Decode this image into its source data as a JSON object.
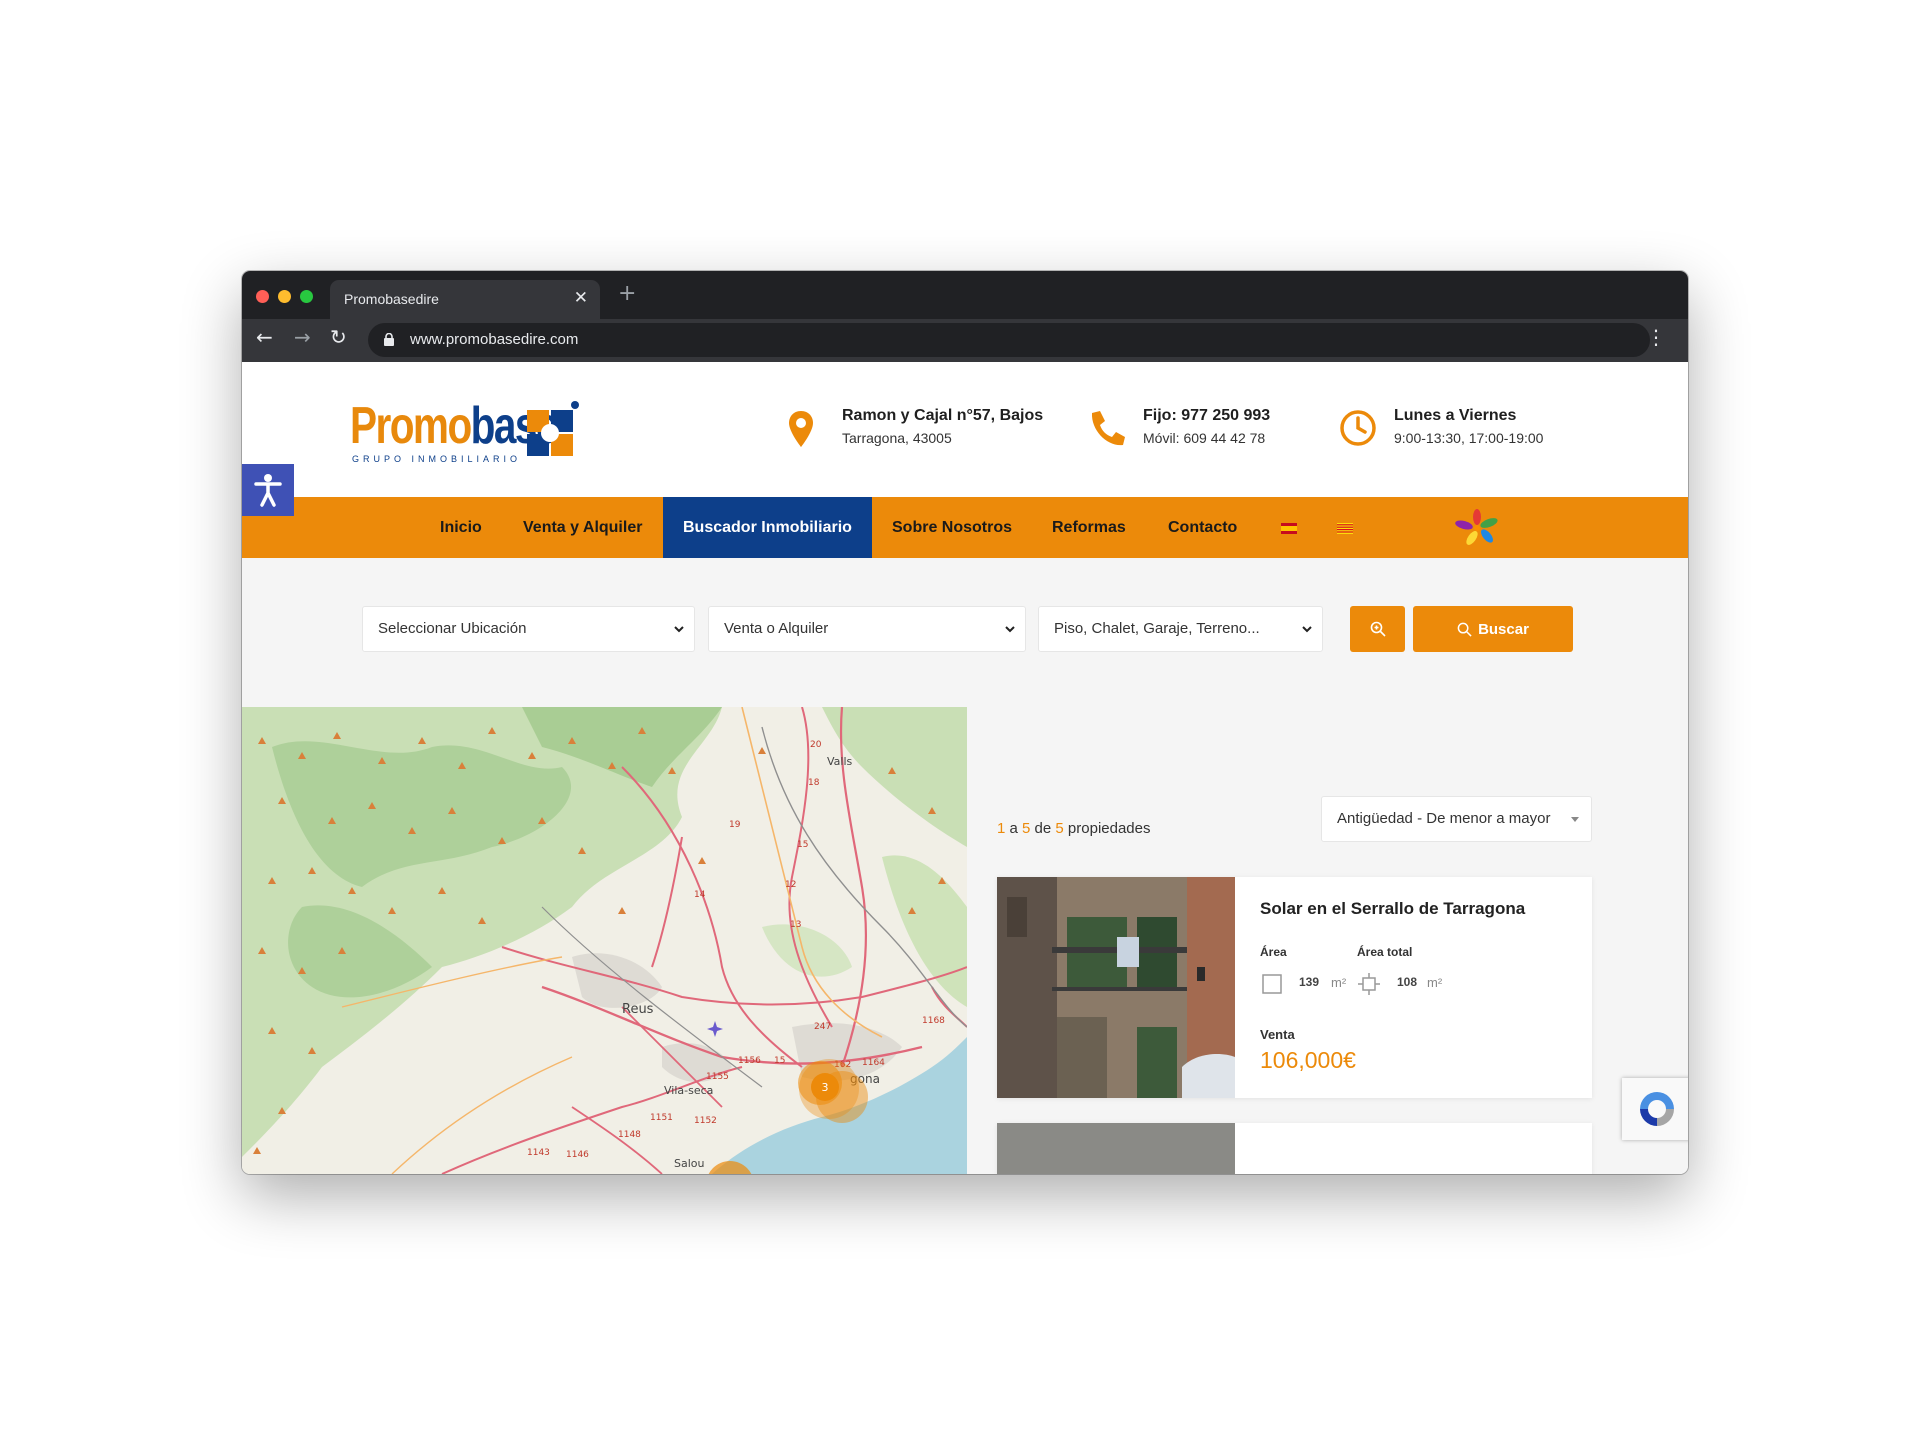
{
  "browser": {
    "tab_title": "Promobasedire",
    "url": "www.promobasedire.com"
  },
  "header": {
    "logo_text_main": "Promo",
    "logo_text_accent": "base",
    "logo_tagline": "GRUPO INMOBILIARIO",
    "address_title": "Ramon y Cajal n°57, Bajos",
    "address_sub": "Tarragona, 43005",
    "phone_title": "Fijo: 977 250 993",
    "phone_sub": "Móvil: 609 44 42 78",
    "hours_title": "Lunes a Viernes",
    "hours_sub": "9:00-13:30, 17:00-19:00"
  },
  "nav": {
    "items": [
      {
        "label": "Inicio"
      },
      {
        "label": "Venta y Alquiler"
      },
      {
        "label": "Buscador Inmobiliario"
      },
      {
        "label": "Sobre Nosotros"
      },
      {
        "label": "Reformas"
      },
      {
        "label": "Contacto"
      }
    ],
    "active": "Buscador Inmobiliario"
  },
  "search": {
    "location": "Seleccionar Ubicación",
    "operation": "Venta o Alquiler",
    "type": "Piso, Chalet, Garaje, Terreno...",
    "button": "Buscar"
  },
  "map": {
    "labels": [
      "Valls",
      "Reus",
      "Vila-seca",
      "Salou",
      "gona"
    ],
    "road_numbers": [
      "20",
      "18",
      "19",
      "15",
      "14",
      "12",
      "13",
      "247",
      "1168",
      "1164",
      "162",
      "1156",
      "1155",
      "1151",
      "1152",
      "1148",
      "1143",
      "1146",
      "15"
    ],
    "cluster_count": "3"
  },
  "results": {
    "from": "1",
    "to": "5",
    "total": "5",
    "word_a": "a",
    "word_de": "de",
    "word_props": "propiedades",
    "sort": "Antigüedad - De menor a mayor"
  },
  "listing": {
    "title": "Solar en el Serrallo de Tarragona",
    "area_label": "Área",
    "area_value": "139",
    "total_label": "Área total",
    "total_value": "108",
    "unit": "m²",
    "operation": "Venta",
    "price": "106,000€"
  },
  "colors": {
    "brand_orange": "#ec8a0a",
    "brand_blue": "#0d3f8a",
    "accessibility": "#3f51b5"
  }
}
